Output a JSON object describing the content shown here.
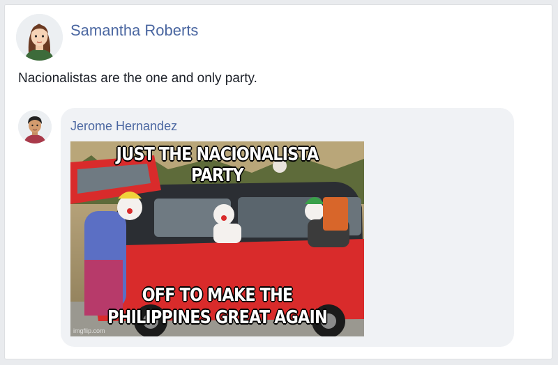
{
  "post": {
    "author": "Samantha Roberts",
    "text": "Nacionalistas are the one and only party."
  },
  "comment": {
    "author": "Jerome Hernandez",
    "meme": {
      "top_caption": "JUST THE NACIONALISTA PARTY",
      "bottom_caption_line1": "OFF TO MAKE THE",
      "bottom_caption_line2": "PHILIPPINES GREAT AGAIN",
      "watermark": "imgflip.com"
    }
  },
  "colors": {
    "link": "#4b67a1",
    "text": "#1d2129",
    "bubble": "#f0f2f5",
    "car": "#d92b2b"
  }
}
